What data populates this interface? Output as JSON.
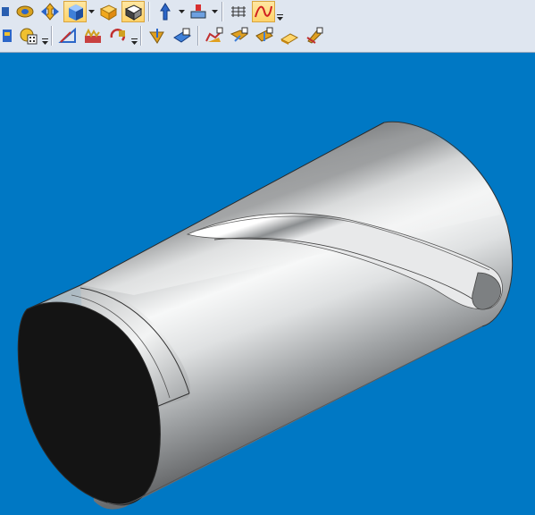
{
  "colors": {
    "toolbar_bg": "#dfe6f0",
    "viewport_bg": "#0078c4",
    "active_button": "#ffd36a",
    "cylinder_end_face": "#141414",
    "cylinder_body_light": "#fbfcfc",
    "cylinder_body_dark": "#6a6c6e"
  },
  "toolbar": {
    "row1": [
      {
        "icon": "partial-view-icon"
      },
      {
        "icon": "rotate-view-icon"
      },
      {
        "icon": "pan-view-icon"
      },
      {
        "icon": "shaded-solid-icon",
        "active": true,
        "dropdown": true
      },
      {
        "icon": "box-front-icon"
      },
      {
        "icon": "box-iso-icon",
        "active": true
      },
      {
        "icon": "arrow-up-icon",
        "dropdown": true
      },
      {
        "icon": "tool-offset-icon",
        "dropdown": true
      },
      {
        "icon": "grid-icon"
      },
      {
        "icon": "toolpath-display-icon",
        "active": true
      }
    ],
    "row2": [
      {
        "icon": "mill-tool-icon"
      },
      {
        "icon": "calculator-settings-icon"
      },
      {
        "icon": "triangle-profile-icon"
      },
      {
        "icon": "rough-machining-icon"
      },
      {
        "icon": "finish-rotation-icon"
      },
      {
        "icon": "drill-arrow-icon"
      },
      {
        "icon": "surface-pocket-icon"
      },
      {
        "icon": "surface-finish-a-icon"
      },
      {
        "icon": "surface-finish-b-icon"
      },
      {
        "icon": "surface-finish-c-icon"
      },
      {
        "icon": "flat-finish-icon"
      },
      {
        "icon": "pencil-finish-icon"
      }
    ]
  }
}
